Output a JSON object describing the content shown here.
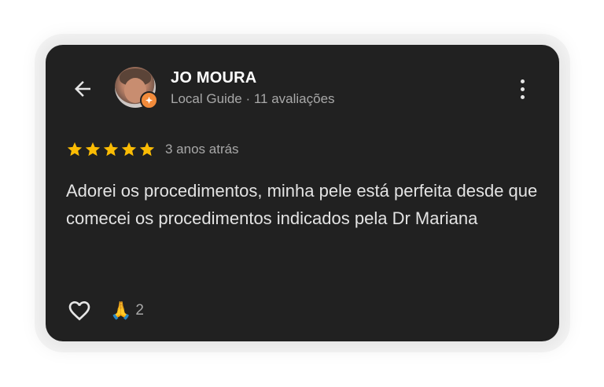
{
  "review": {
    "author": {
      "name": "JO MOURA",
      "meta": "Local Guide · 11 avaliações",
      "avatar_icon": "user-photo",
      "badge_icon": "local-guide-badge-icon"
    },
    "rating": {
      "stars": 5,
      "max_stars": 5,
      "time": "3 anos atrás"
    },
    "text": "Adorei os procedimentos, minha pele está perfeita desde que comecei os procedimentos indicados pela Dr Mariana",
    "reactions": {
      "emoji": "🙏",
      "count": "2"
    }
  },
  "colors": {
    "card_bg": "#212121",
    "star": "#fbbc04",
    "badge": "#f28b3b",
    "text_primary": "#ffffff",
    "text_secondary": "#a8a8a8"
  },
  "icons": {
    "back": "back-arrow-icon",
    "more": "more-vert-icon",
    "like": "heart-outline-icon"
  }
}
